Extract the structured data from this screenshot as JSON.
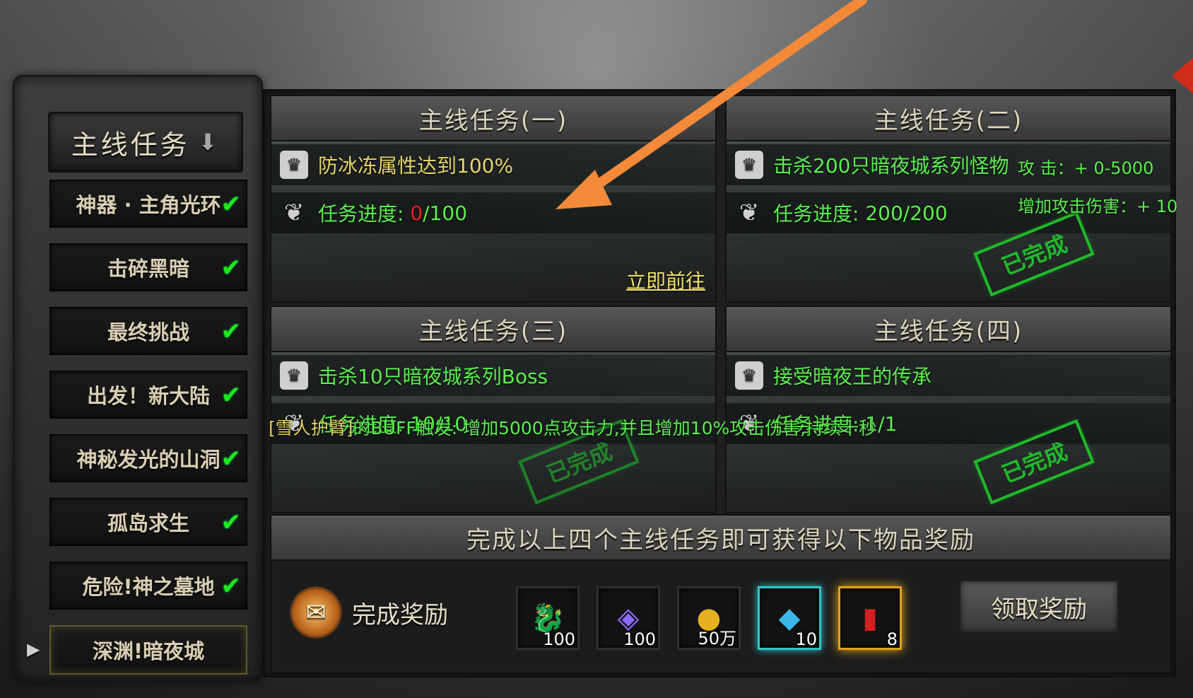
{
  "sidebar": {
    "header": "主线任务",
    "items": [
      {
        "label": "神器 · 主角光环",
        "done": true
      },
      {
        "label": "击碎黑暗",
        "done": true
      },
      {
        "label": "最终挑战",
        "done": true
      },
      {
        "label": "出发！新大陆",
        "done": true
      },
      {
        "label": "神秘发光的山洞",
        "done": true
      },
      {
        "label": "孤岛求生",
        "done": true
      },
      {
        "label": "危险!神之墓地",
        "done": true
      },
      {
        "label": "深渊!暗夜城",
        "done": false,
        "active": true
      }
    ]
  },
  "quests": [
    {
      "title": "主线任务(一)",
      "objective": "防冰冻属性达到100%",
      "progress_label": "任务进度:",
      "progress_current": "0",
      "progress_total": "/100",
      "link": "立即前往",
      "completed": false
    },
    {
      "title": "主线任务(二)",
      "objective": "击杀200只暗夜城系列怪物",
      "progress_label": "任务进度:",
      "progress_current": "200",
      "progress_total": "/200",
      "stamp": "已完成",
      "completed": true
    },
    {
      "title": "主线任务(三)",
      "objective": "击杀10只暗夜城系列Boss",
      "progress_label": "任务进度:",
      "progress_current": "10",
      "progress_total": "/10",
      "stamp": "已完成",
      "completed": true
    },
    {
      "title": "主线任务(四)",
      "objective": "接受暗夜王的传承",
      "progress_label": "任务进度:",
      "progress_current": "1",
      "progress_total": "/1",
      "stamp": "已完成",
      "completed": true
    }
  ],
  "side_stats": {
    "attack": "攻      击：+ 0-5000",
    "damage": "增加攻击伤害：+ 10"
  },
  "buff_message": {
    "item": "[雪人护臂]",
    "text": "的BUFF触发: 增加5000点攻击力,并且增加10%攻击伤害,持续十秒"
  },
  "reward": {
    "title": "完成以上四个主线任务即可获得以下物品奖励",
    "label": "完成奖励",
    "items": [
      {
        "icon": "dragon-orb-icon",
        "qty": "100"
      },
      {
        "icon": "crystal-orb-icon",
        "qty": "100"
      },
      {
        "icon": "gold-coins-icon",
        "qty": "50万"
      },
      {
        "icon": "gem-bundle-icon",
        "qty": "10"
      },
      {
        "icon": "red-book-icon",
        "qty": "8"
      }
    ],
    "claim_button": "领取奖励"
  },
  "colors": {
    "progress_green": "#5bf04f",
    "progress_red": "#f02020",
    "stamp_green": "#1fca2b",
    "link_yellow": "#ece06a",
    "pointer_orange": "#f28a3a"
  }
}
